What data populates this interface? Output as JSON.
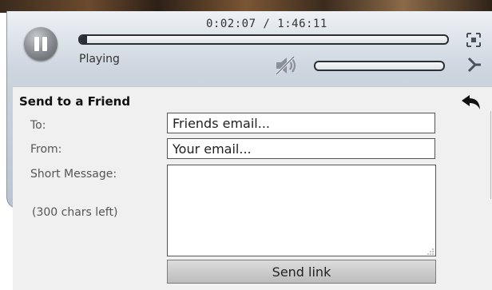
{
  "player": {
    "time_display": "0:02:07 / 1:46:11",
    "status": "Playing",
    "progress": 0.02,
    "volume": 0.0,
    "muted": true,
    "icons": {
      "play_pause": "pause-icon",
      "mute": "speaker-muted-icon",
      "fullscreen": "fullscreen-icon",
      "share": "share-icon"
    }
  },
  "send_form": {
    "title": "Send to a Friend",
    "to_label": "To:",
    "to_placeholder": "Friends email...",
    "from_label": "From:",
    "from_placeholder": "Your email...",
    "message_label": "Short Message:",
    "chars_left": "(300 chars left)",
    "message_value": "",
    "send_label": "Send link",
    "back_icon": "back-arrow-icon"
  },
  "colors": {
    "panel_bg": "#f0f0f0",
    "player_bg": "#c3ccd7",
    "track_dark": "#2b2f35"
  }
}
